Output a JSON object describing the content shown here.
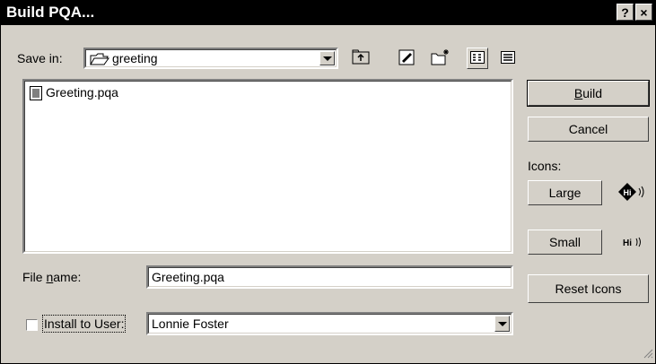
{
  "window": {
    "title": "Build PQA...",
    "help_button": "?",
    "close_button": "×"
  },
  "save_in": {
    "label": "Save in:",
    "folder": "greeting"
  },
  "files": [
    {
      "name": "Greeting.pqa"
    }
  ],
  "file_name": {
    "label": "File name:",
    "value": "Greeting.pqa"
  },
  "install": {
    "label": "Install to User:",
    "checked": false,
    "user": "Lonnie Foster"
  },
  "buttons": {
    "build": "Build",
    "cancel": "Cancel",
    "large": "Large",
    "small": "Small",
    "reset_icons": "Reset Icons"
  },
  "icons": {
    "label": "Icons:",
    "large_preview_text": "Hi",
    "small_preview_text": "Hi"
  }
}
